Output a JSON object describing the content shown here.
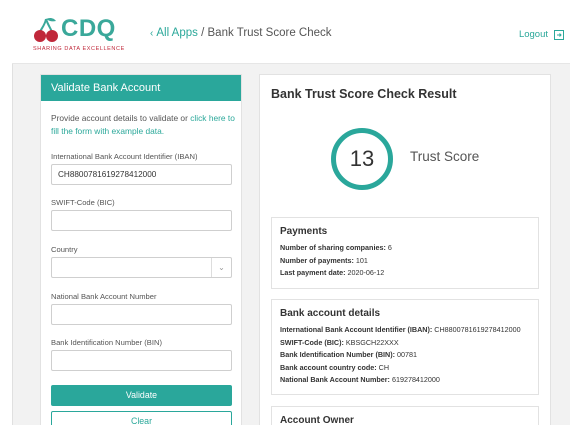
{
  "header": {
    "logo_text": "CDQ",
    "logo_subtitle": "SHARING DATA EXCELLENCE",
    "breadcrumb_all_apps": "All Apps",
    "breadcrumb_separator": "/",
    "breadcrumb_current": "Bank Trust Score Check",
    "logout_label": "Logout"
  },
  "form": {
    "title": "Validate Bank Account",
    "intro_text": "Provide account details to validate or ",
    "intro_link": "click here to fill the form with example data.",
    "iban_label": "International Bank Account Identifier (IBAN)",
    "iban_value": "CH8800781619278412000",
    "swift_label": "SWIFT-Code (BIC)",
    "swift_value": "",
    "country_label": "Country",
    "country_value": "",
    "national_label": "National Bank Account Number",
    "national_value": "",
    "bin_label": "Bank Identification Number (BIN)",
    "bin_value": "",
    "validate_label": "Validate",
    "clear_label": "Clear"
  },
  "result": {
    "title": "Bank Trust Score Check Result",
    "score": "13",
    "score_label": "Trust Score",
    "payments": {
      "title": "Payments",
      "rows": [
        {
          "label": "Number of sharing companies:",
          "value": "6"
        },
        {
          "label": "Number of payments:",
          "value": "101"
        },
        {
          "label": "Last payment date:",
          "value": "2020-06-12"
        }
      ]
    },
    "bank_details": {
      "title": "Bank account details",
      "rows": [
        {
          "label": "International Bank Account Identifier (IBAN):",
          "value": "CH8800781619278412000"
        },
        {
          "label": "SWIFT-Code (BIC):",
          "value": "KBSGCH22XXX"
        },
        {
          "label": "Bank Identification Number (BIN):",
          "value": "00781"
        },
        {
          "label": "Bank account country code:",
          "value": "CH"
        },
        {
          "label": "National Bank Account Number:",
          "value": "619278412000"
        }
      ]
    },
    "owner": {
      "title": "Account Owner"
    }
  },
  "colors": {
    "accent": "#2aa79b",
    "logo_red": "#c0283a"
  }
}
